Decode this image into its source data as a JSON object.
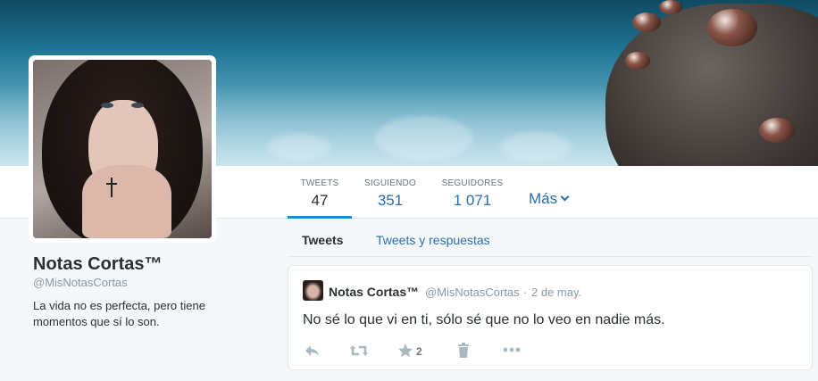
{
  "banner": {},
  "profile": {
    "name": "Notas Cortas™",
    "handle": "@MisNotasCortas",
    "bio": "La vida no es perfecta, pero tiene momentos que sí lo son."
  },
  "stats": [
    {
      "label": "TWEETS",
      "value": "47",
      "active": true
    },
    {
      "label": "SIGUIENDO",
      "value": "351",
      "active": false
    },
    {
      "label": "SEGUIDORES",
      "value": "1 071",
      "active": false
    }
  ],
  "more_label": "Más",
  "tabs": [
    {
      "label": "Tweets",
      "selected": true
    },
    {
      "label": "Tweets y respuestas",
      "selected": false
    }
  ],
  "tweet": {
    "name": "Notas Cortas™",
    "handle": "@MisNotasCortas",
    "separator": "·",
    "date": "2 de may.",
    "text": "No sé lo que vi en ti, sólo sé que no lo veo en nadie más.",
    "favorite_count": "2"
  },
  "icons": {
    "reply": "reply-icon",
    "retweet": "retweet-icon",
    "favorite": "star-icon",
    "delete": "trash-icon",
    "more": "more-dots-icon",
    "more_chevron": "chevron-down-icon"
  },
  "colors": {
    "link": "#2a6db0",
    "accent": "#1d8dcf",
    "muted": "#8899a6",
    "icon": "#aab8c2"
  }
}
